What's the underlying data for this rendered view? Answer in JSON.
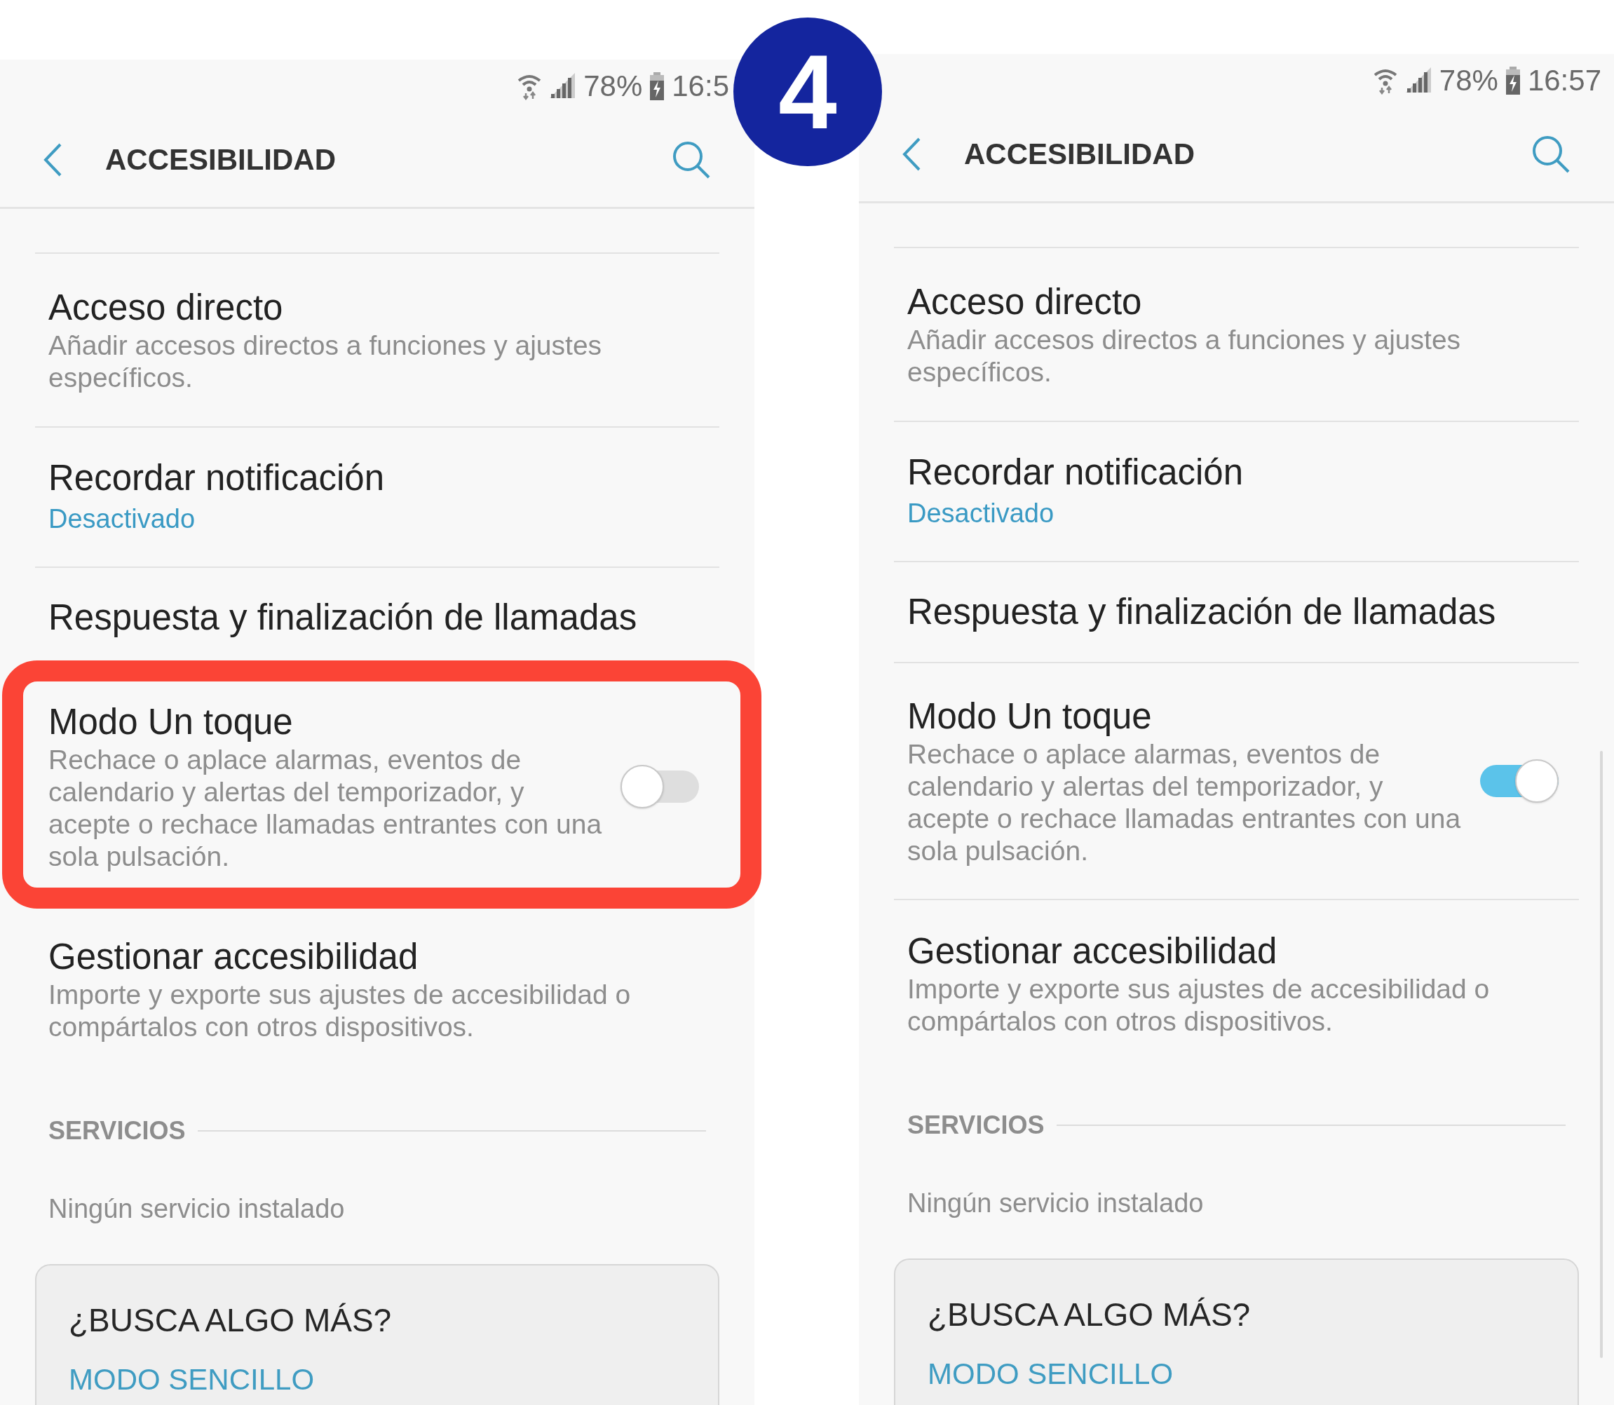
{
  "step_badge": "4",
  "screens": [
    {
      "status_bar": {
        "battery": "78%",
        "time": "16:5"
      },
      "header": {
        "title": "ACCESIBILIDAD"
      },
      "items": [
        {
          "kind": "plain",
          "title": "Acceso directo",
          "subtitle": "Añadir accesos directos a funciones y ajustes específicos."
        },
        {
          "kind": "status",
          "title": "Recordar notificación",
          "status": "Desactivado"
        },
        {
          "kind": "plain",
          "title": "Respuesta y finalización de llamadas"
        },
        {
          "kind": "toggle",
          "title": "Modo Un toque",
          "subtitle": "Rechace o aplace alarmas, eventos de calendario y alertas del temporizador, y acepte o rechace llamadas entrantes con una sola pulsación.",
          "on": false,
          "highlighted": true
        },
        {
          "kind": "plain",
          "title": "Gestionar accesibilidad",
          "subtitle": "Importe y exporte sus ajustes de accesibilidad o compártalos con otros dispositivos."
        }
      ],
      "section": {
        "title": "SERVICIOS",
        "empty_text": "Ningún servicio instalado"
      },
      "card": {
        "title": "¿BUSCA ALGO MÁS?",
        "link": "MODO SENCILLO"
      }
    },
    {
      "status_bar": {
        "battery": "78%",
        "time": "16:57"
      },
      "header": {
        "title": "ACCESIBILIDAD"
      },
      "scrollbar": true,
      "items": [
        {
          "kind": "plain",
          "title": "Acceso directo",
          "subtitle": "Añadir accesos directos a funciones y ajustes específicos."
        },
        {
          "kind": "status",
          "title": "Recordar notificación",
          "status": "Desactivado"
        },
        {
          "kind": "plain",
          "title": "Respuesta y finalización de llamadas"
        },
        {
          "kind": "toggle",
          "title": "Modo Un toque",
          "subtitle": "Rechace o aplace alarmas, eventos de calendario y alertas del temporizador, y acepte o rechace llamadas entrantes con una sola pulsación.",
          "on": true,
          "highlighted": false
        },
        {
          "kind": "plain",
          "title": "Gestionar accesibilidad",
          "subtitle": "Importe y exporte sus ajustes de accesibilidad o compártalos con otros dispositivos."
        }
      ],
      "section": {
        "title": "SERVICIOS",
        "empty_text": "Ningún servicio instalado"
      },
      "card": {
        "title": "¿BUSCA ALGO MÁS?",
        "link": "MODO SENCILLO"
      }
    }
  ]
}
